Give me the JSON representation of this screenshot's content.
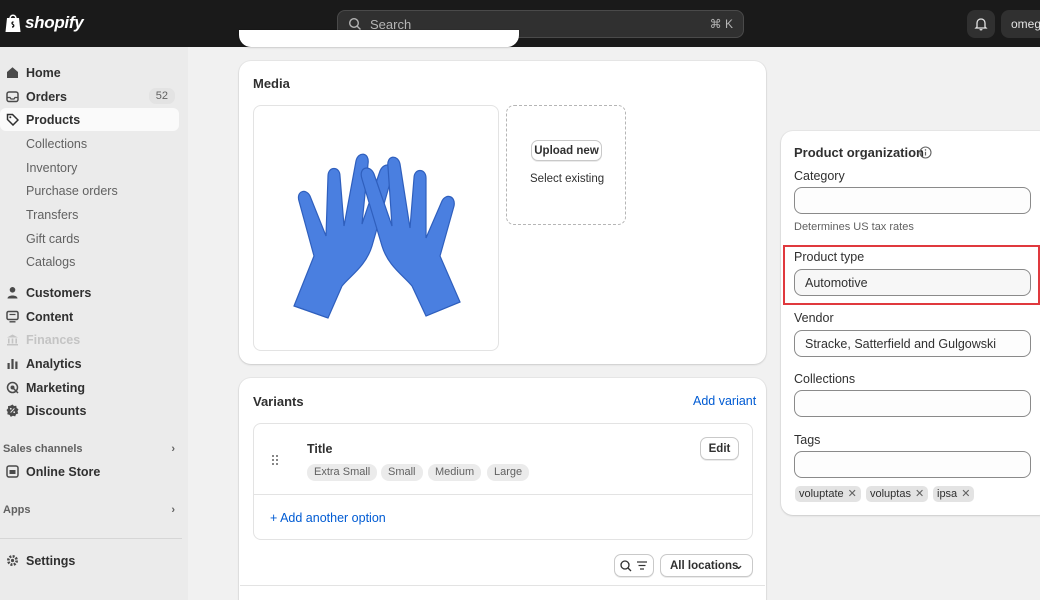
{
  "topbar": {
    "brand": "shopify",
    "search_placeholder": "Search",
    "search_shortcut": "⌘ K",
    "store_name": "omega"
  },
  "sidebar": {
    "home": "Home",
    "orders": "Orders",
    "orders_count": "52",
    "products": "Products",
    "product_subitems": [
      "Collections",
      "Inventory",
      "Purchase orders",
      "Transfers",
      "Gift cards",
      "Catalogs"
    ],
    "customers": "Customers",
    "content": "Content",
    "finances": "Finances",
    "analytics": "Analytics",
    "marketing": "Marketing",
    "discounts": "Discounts",
    "sales_channels": "Sales channels",
    "online_store": "Online Store",
    "apps": "Apps",
    "settings": "Settings"
  },
  "media": {
    "title": "Media",
    "upload_label": "Upload new",
    "select_label": "Select existing"
  },
  "variants": {
    "title": "Variants",
    "add_variant": "Add variant",
    "option_name": "Title",
    "option_values": [
      "Extra Small",
      "Small",
      "Medium",
      "Large"
    ],
    "edit_label": "Edit",
    "add_option": "Add another option",
    "locations_label": "All locations"
  },
  "organization": {
    "title": "Product organization",
    "category_label": "Category",
    "category_value": "",
    "category_help": "Determines US tax rates",
    "type_label": "Product type",
    "type_value": "Automotive",
    "vendor_label": "Vendor",
    "vendor_value": "Stracke, Satterfield and Gulgowski",
    "collections_label": "Collections",
    "collections_value": "",
    "tags_label": "Tags",
    "tags_value": "",
    "tags": [
      "voluptate",
      "voluptas",
      "ipsa"
    ]
  },
  "colors": {
    "accent_link": "#005bd3",
    "highlight": "#e0393e",
    "glove": "#4a7fe0"
  }
}
